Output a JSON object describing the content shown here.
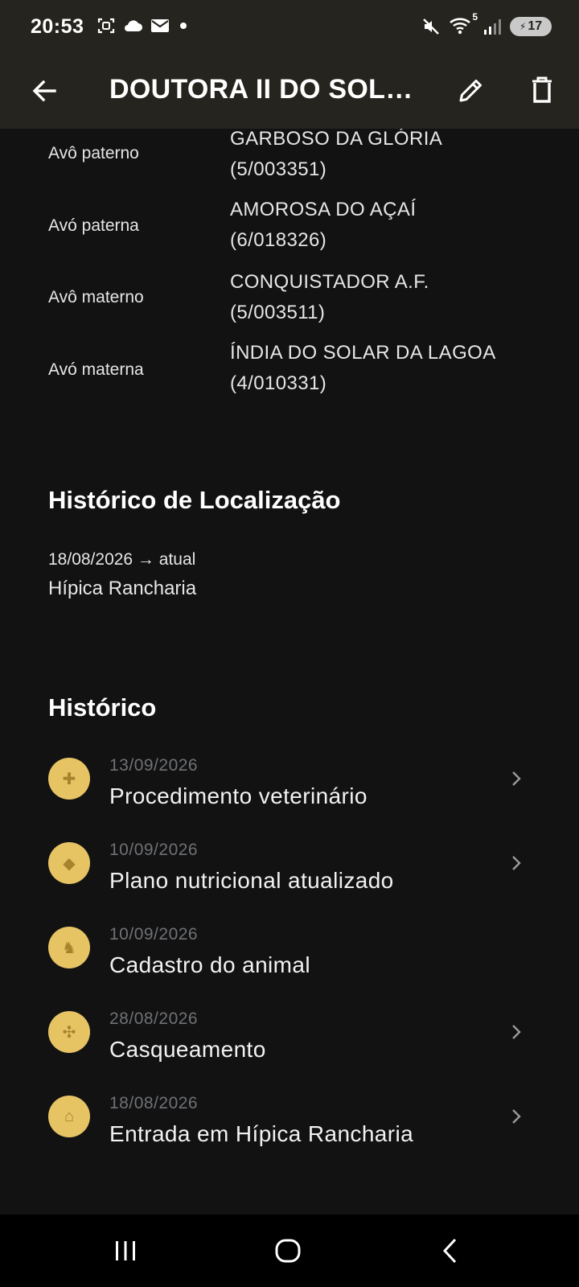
{
  "status_bar": {
    "time": "20:53",
    "battery_level": "17",
    "wifi_label": "5",
    "left_icons": [
      "screenshot-icon",
      "cloud-icon",
      "mail-icon",
      "dot-icon"
    ],
    "right_icons": [
      "mute-icon",
      "wifi-icon",
      "signal-icon",
      "battery-icon"
    ]
  },
  "app_bar": {
    "title": "DOUTORA II DO SOL…",
    "back_icon": "arrow-left-icon",
    "edit_icon": "pencil-icon",
    "delete_icon": "trash-icon"
  },
  "pedigree": [
    {
      "label": "Avô paterno",
      "name": "GARBOSO DA GLÓRIA",
      "code": "(5/003351)"
    },
    {
      "label": "Avó paterna",
      "name": "AMOROSA DO AÇAÍ",
      "code": "(6/018326)"
    },
    {
      "label": "Avô materno",
      "name": "CONQUISTADOR A.F.",
      "code": "(5/003511)"
    },
    {
      "label": "Avó materna",
      "name": "ÍNDIA DO SOLAR DA LAGOA",
      "code": "(4/010331)"
    }
  ],
  "location_history": {
    "title": "Histórico de Localização",
    "entries": [
      {
        "dates": "18/08/2026 → atual",
        "place": "Hípica Rancharia"
      }
    ]
  },
  "history": {
    "title": "Histórico",
    "items": [
      {
        "date": "13/09/2026",
        "title": "Procedimento veterinário",
        "icon": "medical-kit-icon",
        "glyph": "✚",
        "has_chevron": true
      },
      {
        "date": "10/09/2026",
        "title": "Plano nutricional atualizado",
        "icon": "feed-bucket-icon",
        "glyph": "◆",
        "has_chevron": true
      },
      {
        "date": "10/09/2026",
        "title": "Cadastro do animal",
        "icon": "horse-head-icon",
        "glyph": "♞",
        "has_chevron": false
      },
      {
        "date": "28/08/2026",
        "title": "Casqueamento",
        "icon": "horseshoe-icon",
        "glyph": "✣",
        "has_chevron": true
      },
      {
        "date": "18/08/2026",
        "title": "Entrada em Hípica Rancharia",
        "icon": "barn-icon",
        "glyph": "⌂",
        "has_chevron": true
      }
    ]
  },
  "nav_bar": {
    "recent_icon": "recent-apps-icon",
    "home_icon": "home-icon",
    "back_icon": "nav-back-icon"
  },
  "colors": {
    "background": "#121212",
    "app_bar": "#26241e",
    "avatar": "#e6c363",
    "date_text": "#6f7175"
  }
}
